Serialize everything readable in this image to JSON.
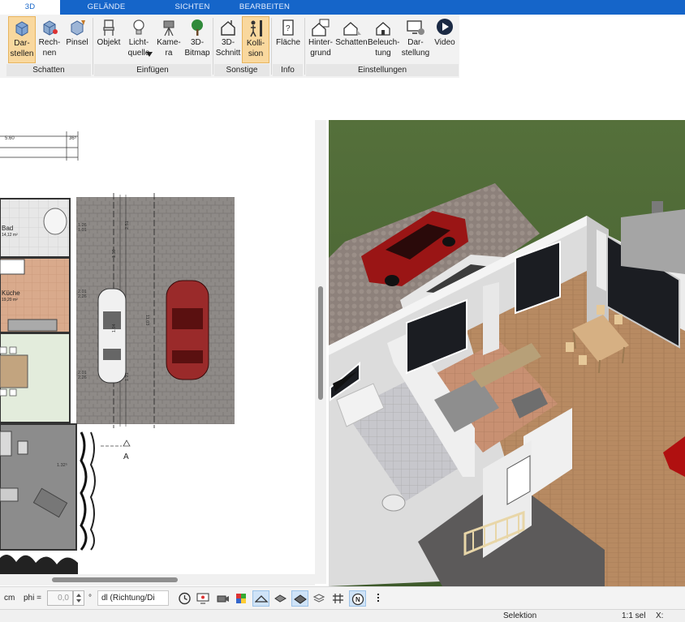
{
  "tabs": [
    {
      "label": "3D",
      "active": true
    },
    {
      "label": "GELÄNDE",
      "active": false
    },
    {
      "label": "SICHTEN",
      "active": false
    },
    {
      "label": "BEARBEITEN",
      "active": false
    }
  ],
  "ribbon": {
    "buttons": {
      "darstellen": "Dar-\nstellen",
      "rechnen": "Rech-\nnen",
      "pinsel": "Pinsel",
      "objekt": "Objekt",
      "lichtquelle": "Licht-\nquelle",
      "kamera": "Kame-\nra",
      "bitmap": "3D-\nBitmap",
      "schnitt": "3D-\nSchnitt",
      "kollision": "Kolli-\nsion",
      "flaeche": "Fläche",
      "hintergrund": "Hinter-\ngrund",
      "schatten": "Schatten",
      "beleuchtung": "Beleuch-\ntung",
      "darstellung": "Dar-\nstellung",
      "video": "Video"
    },
    "groups": {
      "schatten": "Schatten",
      "einfuegen": "Einfügen",
      "sonstige": "Sonstige",
      "info": "Info",
      "einstellungen": "Einstellungen"
    }
  },
  "plan": {
    "rooms": {
      "bad_name": "Bad",
      "bad_area": "14,12 m²",
      "kueche_name": "Küche",
      "kueche_area": "19,20 m²"
    },
    "dimensions": {
      "top_main": "5.60",
      "top_right": "36⁵",
      "d1": "1.26",
      "d2": "1.01",
      "d3": "2.01",
      "d4": "2.26",
      "d5": "2.01",
      "d6": "2.26",
      "d7": "1.32⁵",
      "d8": "11.03",
      "d9": "1.59",
      "d10": "1.94",
      "d11": "2.51",
      "d12": "1.21"
    },
    "section_marker": "A"
  },
  "bottom_toolbar": {
    "unit": "cm",
    "phi_label": "phi =",
    "phi_value": "0,0",
    "degree": "°",
    "direction_select": "dl (Richtung/Di",
    "icons": [
      "clock-icon",
      "monitor-icon",
      "camera-icon",
      "material-icon",
      "layer-icon",
      "perspective-icon",
      "plane-icon",
      "stack-icon",
      "grid-icon",
      "north-icon",
      "more-icon"
    ]
  },
  "status": {
    "mode": "Selektion",
    "scale": "1:1 sel",
    "x_label": "X:"
  },
  "colors": {
    "ribbon_tab_bar": "#1565c9",
    "active_button": "#f9d89e",
    "grass": "#4a6b34",
    "floor_wood": "#b9895f",
    "car_red": "#8e1414"
  }
}
